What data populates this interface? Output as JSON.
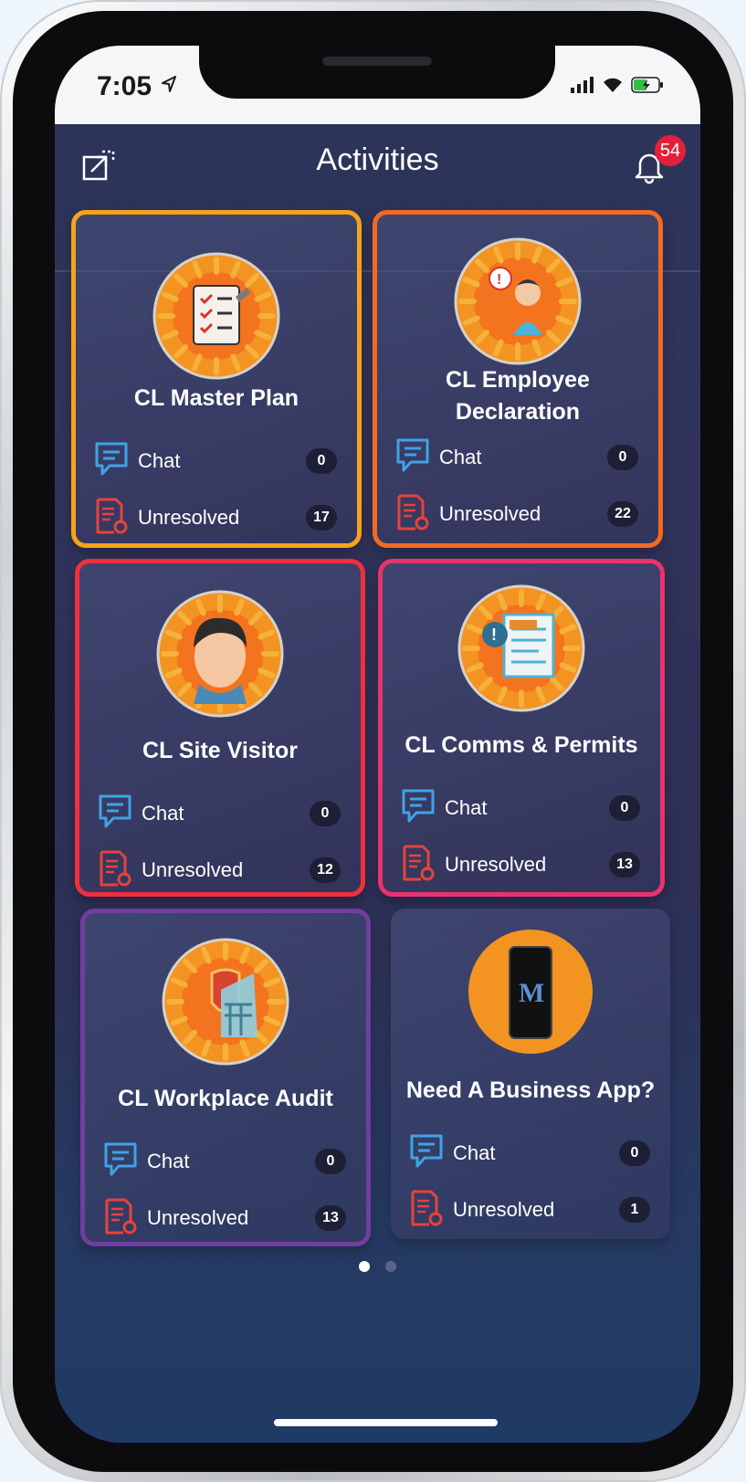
{
  "status_bar": {
    "time": "7:05"
  },
  "header": {
    "title": "Activities",
    "notification_count": "54"
  },
  "cards": [
    {
      "title_lines": [
        "CL Master Plan"
      ],
      "chat_label": "Chat",
      "chat_count": "0",
      "unresolved_label": "Unresolved",
      "unresolved_count": "17",
      "highlight": "#f7a21b"
    },
    {
      "title_lines": [
        "CL Employee",
        "Declaration"
      ],
      "chat_label": "Chat",
      "chat_count": "0",
      "unresolved_label": "Unresolved",
      "unresolved_count": "22",
      "highlight": "#f26a21"
    },
    {
      "title_lines": [
        "CL Site Visitor"
      ],
      "chat_label": "Chat",
      "chat_count": "0",
      "unresolved_label": "Unresolved",
      "unresolved_count": "12",
      "highlight": "#ef2f3c"
    },
    {
      "title_lines": [
        "CL Comms & Permits"
      ],
      "chat_label": "Chat",
      "chat_count": "0",
      "unresolved_label": "Unresolved",
      "unresolved_count": "13",
      "highlight": "#e8336d"
    },
    {
      "title_lines": [
        "CL Workplace Audit"
      ],
      "chat_label": "Chat",
      "chat_count": "0",
      "unresolved_label": "Unresolved",
      "unresolved_count": "13",
      "highlight": "#6f3fa0"
    },
    {
      "title_lines": [
        "Need A Business App?"
      ],
      "chat_label": "Chat",
      "chat_count": "0",
      "unresolved_label": "Unresolved",
      "unresolved_count": "1",
      "highlight": ""
    }
  ],
  "card_icons": [
    "checklist-icon",
    "employee-alert-icon",
    "visitor-face-icon",
    "document-alert-icon",
    "shield-building-icon",
    "phone-m-logo-icon"
  ],
  "pager": {
    "pages": 2,
    "current": 1
  },
  "colors": {
    "chat_icon": "#3fa3e6",
    "unresolved_icon": "#e8423a",
    "badge": "#e1213b",
    "icon_circle": "#f39422"
  }
}
